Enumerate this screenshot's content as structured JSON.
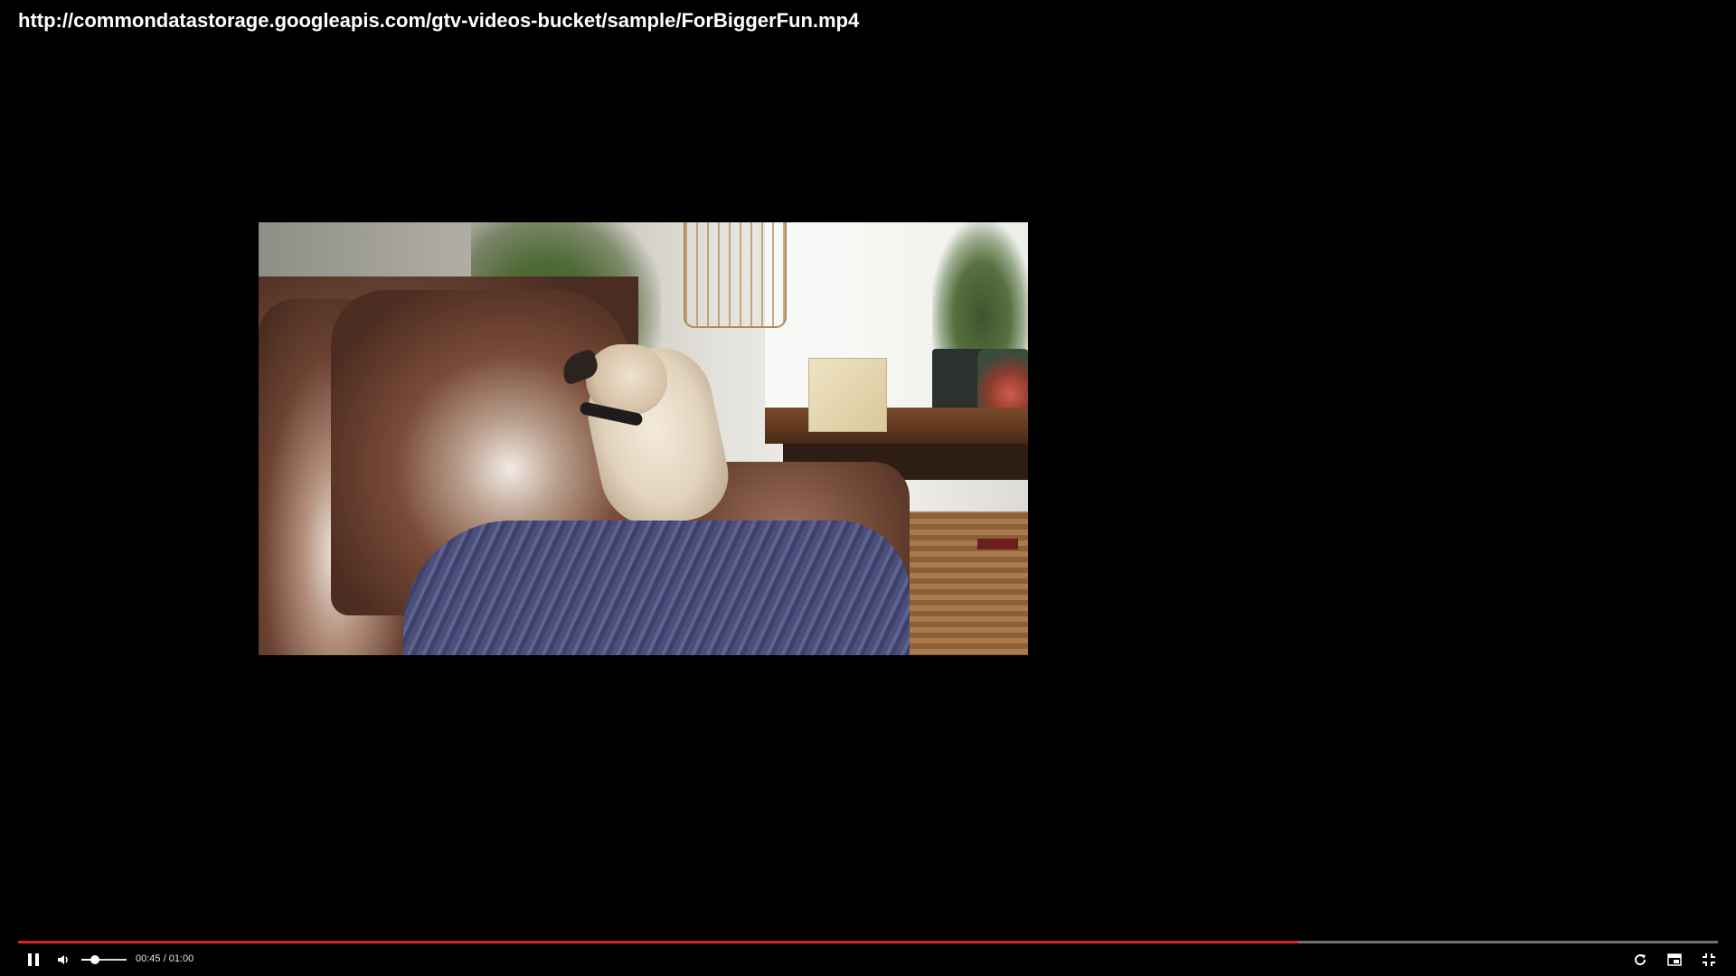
{
  "video": {
    "url_title": "http://commondatastorage.googleapis.com/gtv-videos-bucket/sample/ForBiggerFun.mp4",
    "frame_description": "Pug sitting upright on a leather sofa"
  },
  "player": {
    "progress_fraction": 0.753,
    "volume_fraction": 0.3,
    "time_current": "00:45",
    "time_separator": "/",
    "time_total": "01:00",
    "time_text": "00:45 / 01:00",
    "colors": {
      "progress_played": "#d32626",
      "progress_track": "#6f6f6f",
      "background": "#000000"
    },
    "icons": {
      "play_pause": "pause-icon",
      "volume": "volume-icon",
      "replay": "replay-icon",
      "pip": "picture-in-picture-icon",
      "fullscreen": "exit-fullscreen-icon"
    }
  }
}
